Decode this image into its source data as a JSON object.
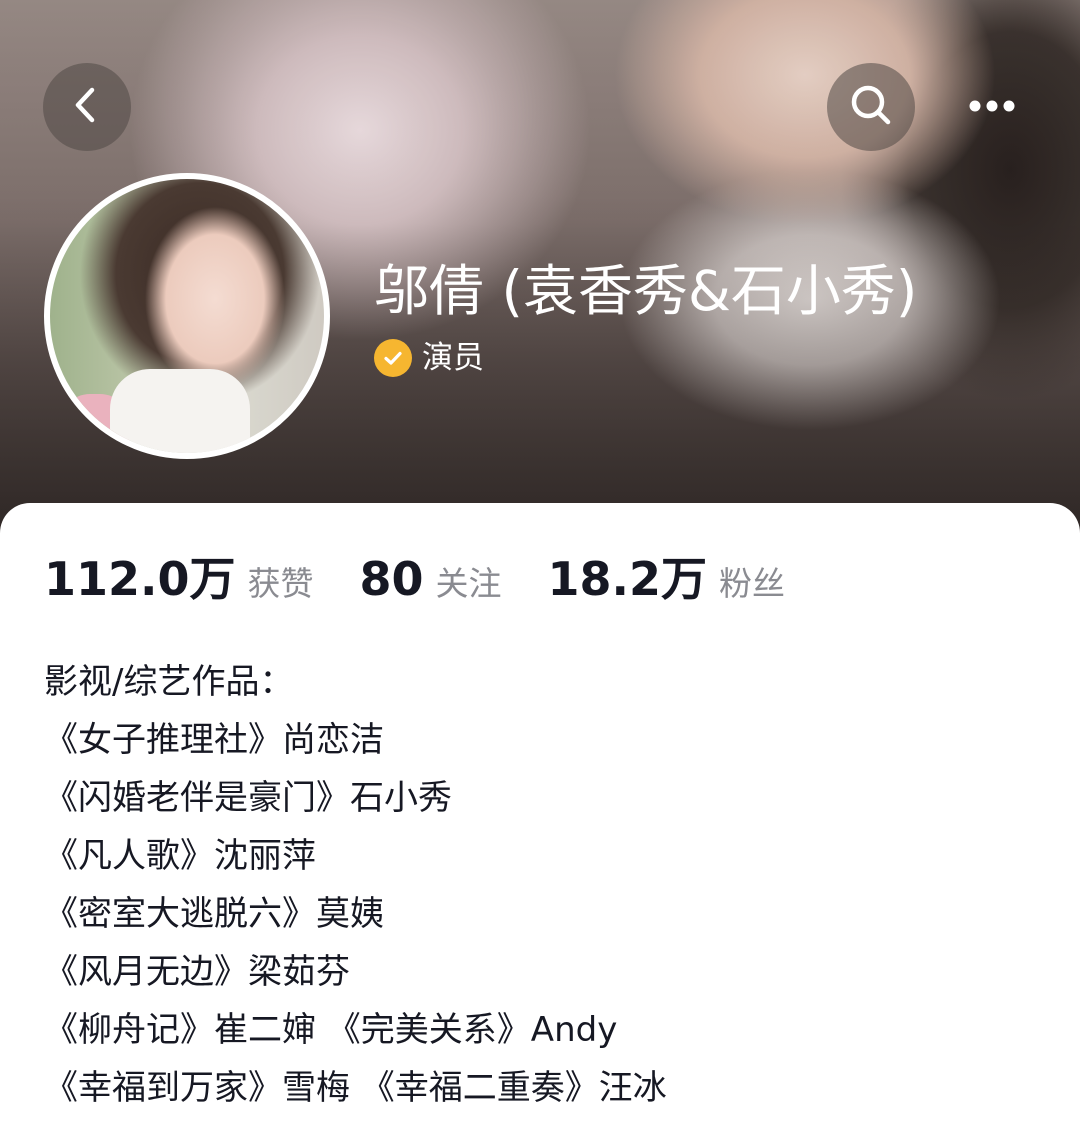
{
  "header": {
    "icons": {
      "back": "chevron-left-icon",
      "search": "search-icon",
      "more": "more-horizontal-icon"
    }
  },
  "profile": {
    "name": "邬倩 (袁香秀&石小秀)",
    "verification_label": "演员",
    "verification_icon": "verified-check-icon",
    "verification_color": "#f6b630"
  },
  "stats": [
    {
      "value": "112.0万",
      "label": "获赞"
    },
    {
      "value": "80",
      "label": "关注"
    },
    {
      "value": "18.2万",
      "label": "粉丝"
    }
  ],
  "bio": {
    "lines": [
      "影视/综艺作品：",
      "《女子推理社》尚恋洁",
      "《闪婚老伴是豪门》石小秀",
      "《凡人歌》沈丽萍",
      "《密室大逃脱六》莫姨",
      "《风月无边》梁茹芬",
      "《柳舟记》崔二婶 《完美关系》Andy",
      "《幸福到万家》雪梅 《幸福二重奏》汪冰"
    ]
  }
}
